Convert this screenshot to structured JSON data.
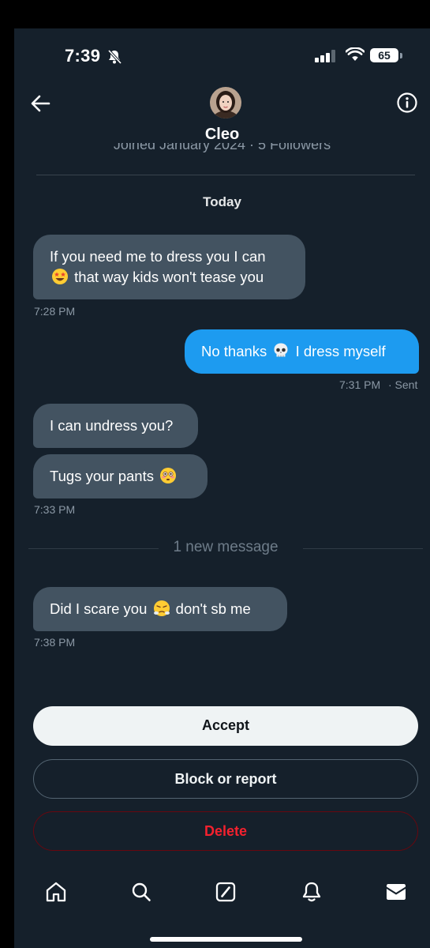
{
  "status_bar": {
    "time": "7:39",
    "battery": "65"
  },
  "header": {
    "contact_name": "Cleo",
    "profile_meta": "Joined January 2024 · 5 Followers"
  },
  "conversation": {
    "date_label": "Today",
    "messages": [
      {
        "direction": "received",
        "line1": "If you need me to dress you I can",
        "line2": "that way kids won't tease you",
        "time": "7:28 PM"
      },
      {
        "direction": "sent",
        "text_before": "No thanks",
        "text_after": "I dress myself",
        "time": "7:31 PM",
        "status": "· Sent"
      },
      {
        "direction": "received",
        "text": "I can undress you?"
      },
      {
        "direction": "received",
        "text": "Tugs your pants",
        "time": "7:33 PM"
      },
      {
        "direction": "received",
        "text_before": "Did I scare you",
        "text_after": "don't sb me",
        "time": "7:38 PM"
      }
    ],
    "new_message_divider": "1 new message"
  },
  "request_actions": {
    "accept_label": "Accept",
    "block_label": "Block or report",
    "delete_label": "Delete"
  },
  "bottom_nav": [
    "home-icon",
    "search-icon",
    "grok-icon",
    "notifications-icon",
    "messages-icon"
  ],
  "colors": {
    "background": "#15202b",
    "received_bubble": "#435361",
    "sent_bubble": "#1d9bf0",
    "delete_red": "#f4212e"
  }
}
